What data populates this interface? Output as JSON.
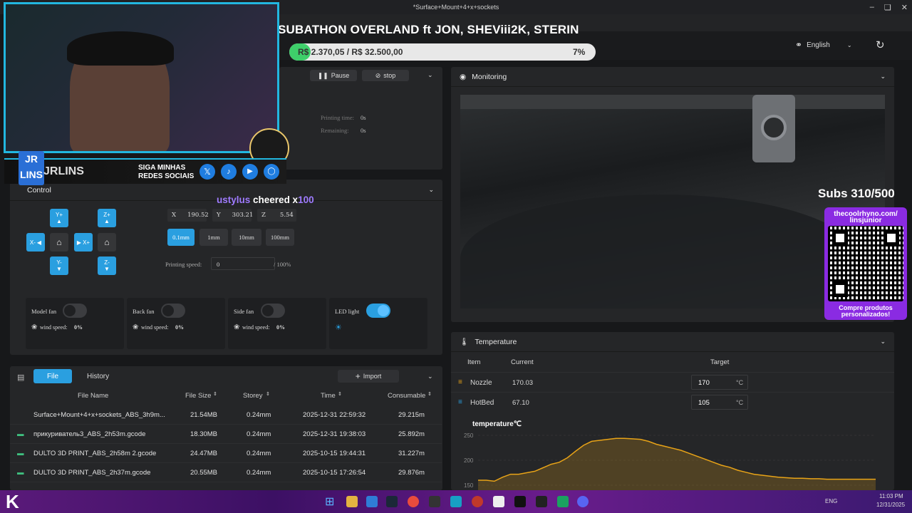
{
  "window": {
    "title": "*Surface+Mount+4+x+sockets"
  },
  "overlay": {
    "event_title": "SUBATHON OVERLAND ft JON, SHEViii2K, STERIN",
    "goal_text": "R$ 2.370,05 / R$ 32.500,00",
    "goal_percent_label": "7%",
    "goal_progress": 7,
    "streamer_tag": "JRLINS",
    "social_label_1": "SIGA MINHAS",
    "social_label_2": "REDES SOCIAIS",
    "cheer_user": "ustylus",
    "cheer_text": "cheered x",
    "cheer_amount": "100",
    "subs_text": "Subs 310/500",
    "qr_top_1": "thecoolrhyno.com/",
    "qr_top_2": "linsjunior",
    "qr_bottom_1": "Compre produtos",
    "qr_bottom_2": "personalizados!"
  },
  "header": {
    "language": "English"
  },
  "print_panel": {
    "pause_label": "Pause",
    "stop_label": "stop",
    "printing_time_label": "Printing time:",
    "printing_time_value": "0s",
    "remaining_label": "Remaining:",
    "remaining_value": "0s"
  },
  "control": {
    "title": "Control",
    "jog": {
      "y_plus": "Y+",
      "y_minus": "Y-",
      "x_minus": "X-",
      "x_plus": "X+",
      "z_plus": "Z+",
      "z_minus": "Z-"
    },
    "coords": {
      "x_label": "X",
      "x_value": "190.52",
      "y_label": "Y",
      "y_value": "303.21",
      "z_label": "Z",
      "z_value": "5.54"
    },
    "steps": [
      "0.1mm",
      "1mm",
      "10mm",
      "100mm"
    ],
    "speed_label": "Printing speed:",
    "speed_value": "0",
    "speed_suffix": "/ 100%",
    "fans": [
      {
        "name": "Model fan",
        "speed_label": "wind speed:",
        "speed": "0%"
      },
      {
        "name": "Back fan",
        "speed_label": "wind speed:",
        "speed": "0%"
      },
      {
        "name": "Side fan",
        "speed_label": "wind speed:",
        "speed": "0%"
      }
    ],
    "led_label": "LED light"
  },
  "files": {
    "tab_file": "File",
    "tab_history": "History",
    "import_label": "Import",
    "columns": [
      "File Name",
      "File Size",
      "Storey",
      "Time",
      "Consumable"
    ],
    "rows": [
      {
        "name": "Surface+Mount+4+x+sockets_ABS_3h9m...",
        "size": "21.54MB",
        "storey": "0.24mm",
        "time": "2025-12-31 22:59:32",
        "consumable": "29.215m"
      },
      {
        "name": "прикуриватель3_ABS_2h53m.gcode",
        "size": "18.30MB",
        "storey": "0.24mm",
        "time": "2025-12-31 19:38:03",
        "consumable": "25.892m"
      },
      {
        "name": "DULTO 3D PRINT_ABS_2h58m 2.gcode",
        "size": "24.47MB",
        "storey": "0.24mm",
        "time": "2025-10-15 19:44:31",
        "consumable": "31.227m"
      },
      {
        "name": "DULTO 3D PRINT_ABS_2h37m.gcode",
        "size": "20.55MB",
        "storey": "0.24mm",
        "time": "2025-10-15 17:26:54",
        "consumable": "29.876m"
      }
    ]
  },
  "monitoring": {
    "title": "Monitoring"
  },
  "temperature": {
    "title": "Temperature",
    "col_item": "Item",
    "col_current": "Current",
    "col_target": "Target",
    "rows": [
      {
        "name": "Nozzle",
        "current": "170.03",
        "target": "170",
        "unit": "°C"
      },
      {
        "name": "HotBed",
        "current": "67.10",
        "target": "105",
        "unit": "°C"
      }
    ],
    "chart_title": "temperature℃"
  },
  "chart_data": {
    "type": "area",
    "title": "temperature℃",
    "yticks": [
      250,
      200,
      150
    ],
    "ylim": [
      140,
      260
    ],
    "values": [
      160,
      160,
      158,
      166,
      172,
      172,
      175,
      178,
      185,
      192,
      196,
      205,
      218,
      230,
      238,
      240,
      242,
      244,
      244,
      243,
      242,
      238,
      232,
      228,
      224,
      220,
      214,
      208,
      202,
      196,
      190,
      186,
      180,
      176,
      172,
      170,
      168,
      166,
      165,
      164,
      164,
      163,
      163,
      162,
      162,
      162,
      162,
      162,
      162,
      162
    ],
    "color": "#e8a317"
  },
  "colors": {
    "accent": "#2a9fe0",
    "temp_line": "#e8a317",
    "twitch_purple": "#9146ff"
  },
  "taskbar": {
    "lang": "ENG",
    "time": "11:03 PM",
    "date": "12/31/2025"
  }
}
